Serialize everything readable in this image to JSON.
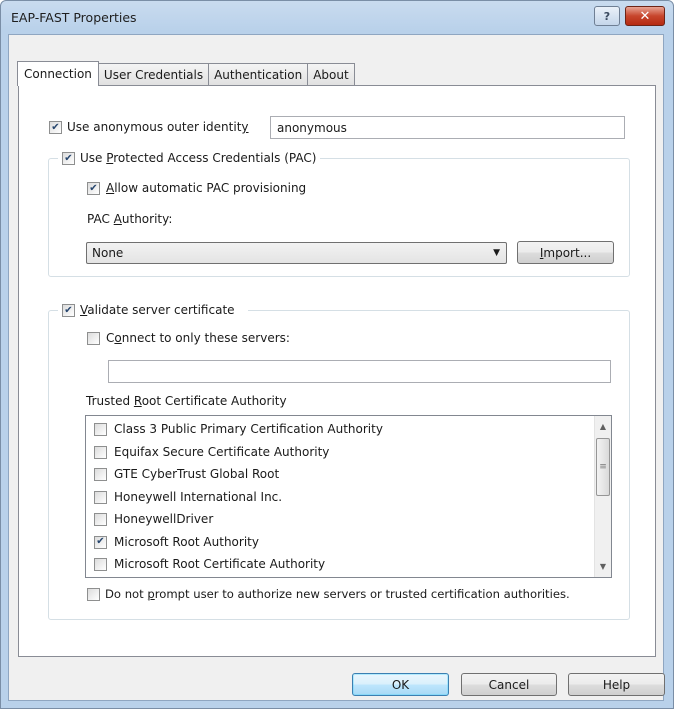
{
  "window": {
    "title": "EAP-FAST Properties",
    "help_glyph": "?",
    "close_glyph": "✕"
  },
  "tabs": [
    {
      "label": "Connection",
      "active": true
    },
    {
      "label": "User Credentials",
      "active": false
    },
    {
      "label": "Authentication",
      "active": false
    },
    {
      "label": "About",
      "active": false
    }
  ],
  "anon": {
    "label_pre": "Use anonymous outer identit",
    "label_ul": "y",
    "checked": true,
    "value": "anonymous"
  },
  "pac": {
    "label_pre": "Use ",
    "label_ul": "P",
    "label_post": "rotected Access Credentials (PAC)",
    "checked": true,
    "auto_pre": "",
    "auto_ul": "A",
    "auto_post": "llow automatic PAC provisioning",
    "auto_checked": true,
    "authority_pre": "PAC ",
    "authority_ul": "A",
    "authority_post": "uthority:",
    "combo_value": "None",
    "import_ul": "I",
    "import_post": "mport..."
  },
  "validate": {
    "label_ul": "V",
    "label_post": "alidate server certificate",
    "checked": true,
    "connect_pre": "C",
    "connect_ul": "o",
    "connect_post": "nnect to only these servers:",
    "connect_checked": false,
    "servers_value": "",
    "trusted_pre": "Trusted ",
    "trusted_ul": "R",
    "trusted_post": "oot Certificate Authority",
    "cas": [
      {
        "name": "Class 3 Public Primary Certification Authority",
        "checked": false
      },
      {
        "name": "Equifax Secure Certificate Authority",
        "checked": false
      },
      {
        "name": "GTE CyberTrust Global Root",
        "checked": false
      },
      {
        "name": "Honeywell International Inc.",
        "checked": false
      },
      {
        "name": "HoneywellDriver",
        "checked": false
      },
      {
        "name": "Microsoft Root Authority",
        "checked": true
      },
      {
        "name": "Microsoft Root Certificate Authority",
        "checked": false
      }
    ],
    "prompt_pre": "Do not ",
    "prompt_ul": "p",
    "prompt_post": "rompt user to authorize new servers or trusted certification authorities.",
    "prompt_checked": false
  },
  "footer": {
    "ok": "OK",
    "cancel": "Cancel",
    "help": "Help"
  }
}
